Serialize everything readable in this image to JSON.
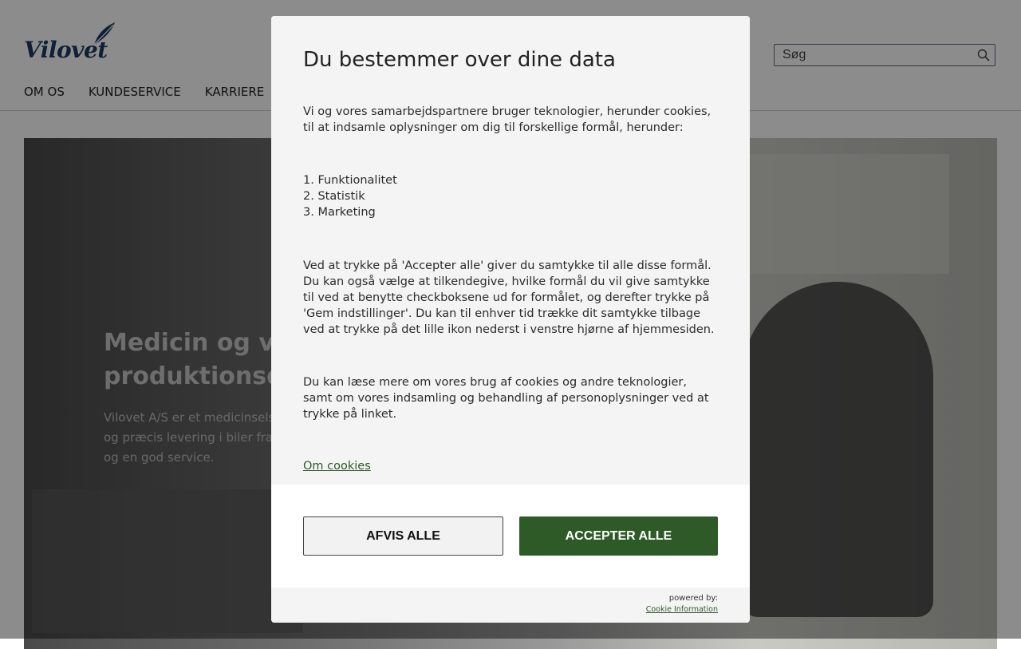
{
  "brand": {
    "logo_text": "Vilovet",
    "logo_color": "#1f3a5f"
  },
  "header": {
    "search_placeholder": "Søg",
    "search_icon": "search-icon",
    "nav": [
      {
        "label": "OM OS"
      },
      {
        "label": "KUNDESERVICE"
      },
      {
        "label": "KARRIERE"
      }
    ]
  },
  "hero": {
    "title_line1": "Medicin og vac",
    "title_line2": "produktionsdy",
    "text_line1": "Vilovet A/S er et medicinsels",
    "text_line2": "og præcis levering i biler fra",
    "text_line3": "og en god service."
  },
  "consent": {
    "title": "Du bestemmer over dine data",
    "intro": "Vi og vores samarbejdspartnere bruger teknologier, herunder cookies, til at indsamle oplysninger om dig til forskellige formål, herunder:",
    "purposes": [
      "1. Funktionalitet",
      "2. Statistik",
      "3. Marketing"
    ],
    "accept_info": "Ved at trykke på 'Accepter alle' giver du samtykke til alle disse formål. Du kan også vælge at tilkendegive, hvilke formål du vil give samtykke til ved at benytte checkboksene ud for formålet, og derefter trykke på 'Gem indstillinger'. Du kan til enhver tid trække dit samtykke tilbage ved at trykke på det lille ikon nederst i venstre hjørne af hjemmesiden.",
    "more_info": "Du kan læse mere om vores brug af cookies og andre teknologier, samt om vores indsamling og behandling af personoplysninger ved at trykke på linket.",
    "cookies_link": "Om cookies",
    "reject_label": "AFVIS ALLE",
    "accept_label": "ACCEPTER ALLE",
    "powered_by": "powered by:",
    "provider_link": "Cookie Information",
    "accent_color": "#2d5a27"
  }
}
